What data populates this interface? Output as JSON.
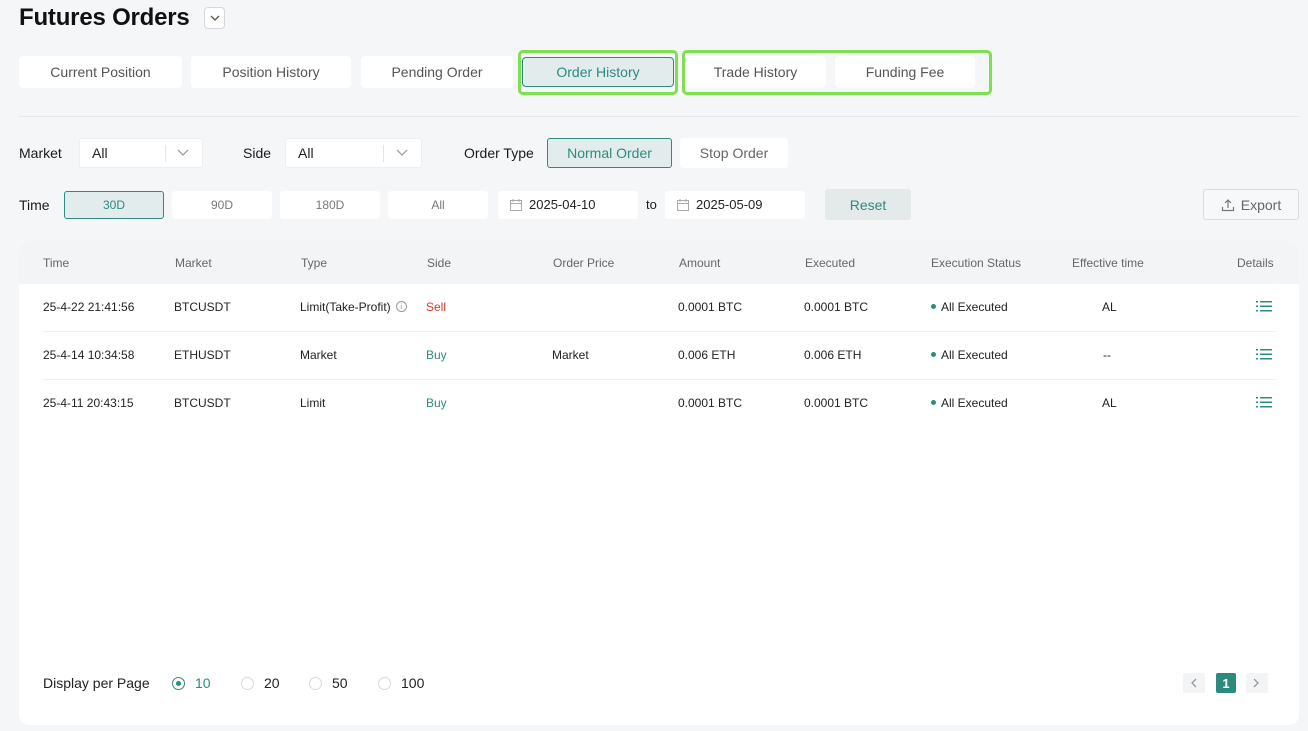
{
  "page": {
    "title": "Futures Orders"
  },
  "tabs": [
    {
      "label": "Current Position"
    },
    {
      "label": "Position History"
    },
    {
      "label": "Pending Order"
    },
    {
      "label": "Order History",
      "active": true
    },
    {
      "label": "Trade History"
    },
    {
      "label": "Funding Fee"
    }
  ],
  "filters": {
    "market_label": "Market",
    "market_value": "All",
    "side_label": "Side",
    "side_value": "All",
    "order_type_label": "Order Type",
    "order_types": [
      "Normal Order",
      "Stop Order"
    ],
    "order_type_selected": "Normal Order",
    "time_label": "Time",
    "time_ranges": [
      "30D",
      "90D",
      "180D",
      "All"
    ],
    "time_selected": "30D",
    "date_from": "2025-04-10",
    "date_to_sep": "to",
    "date_to": "2025-05-09",
    "reset_label": "Reset",
    "export_label": "Export"
  },
  "table": {
    "columns": [
      "Time",
      "Market",
      "Type",
      "Side",
      "Order Price",
      "Amount",
      "Executed",
      "Execution Status",
      "Effective time",
      "Details"
    ],
    "rows": [
      {
        "time": "25-4-22 21:41:56",
        "market": "BTCUSDT",
        "type": "Limit(Take-Profit)",
        "side": "Sell",
        "order_price": "",
        "amount": "0.0001 BTC",
        "executed": "0.0001 BTC",
        "status": "All Executed",
        "effective": "AL"
      },
      {
        "time": "25-4-14 10:34:58",
        "market": "ETHUSDT",
        "type": "Market",
        "side": "Buy",
        "order_price": "Market",
        "amount": "0.006 ETH",
        "executed": "0.006 ETH",
        "status": "All Executed",
        "effective": "--"
      },
      {
        "time": "25-4-11 20:43:15",
        "market": "BTCUSDT",
        "type": "Limit",
        "side": "Buy",
        "order_price": "",
        "amount": "0.0001 BTC",
        "executed": "0.0001 BTC",
        "status": "All Executed",
        "effective": "AL"
      }
    ]
  },
  "pagination": {
    "per_page_label": "Display per Page",
    "options": [
      "10",
      "20",
      "50",
      "100"
    ],
    "selected": "10",
    "current_page": "1"
  },
  "colors": {
    "accent": "#2d8a7f",
    "sell": "#d13b2b",
    "highlight": "#7ee050"
  }
}
